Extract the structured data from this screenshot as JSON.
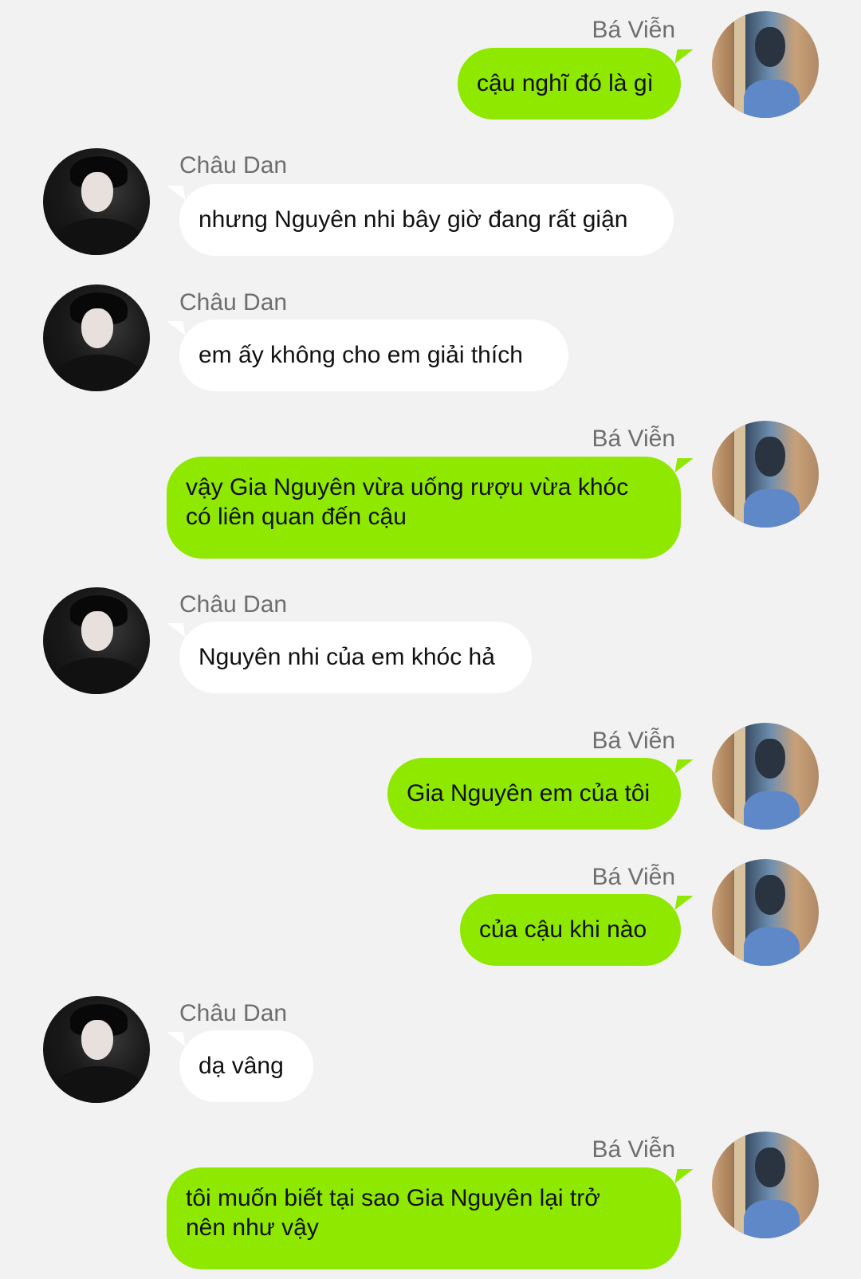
{
  "messages": [
    {
      "sender": "Bá Viễn",
      "text": "cậu nghĩ đó là gì"
    },
    {
      "sender": "Châu Dan",
      "text": "nhưng Nguyên nhi bây giờ đang rất giận"
    },
    {
      "sender": "Châu Dan",
      "text": "em ấy không cho em giải thích"
    },
    {
      "sender": "Bá Viễn",
      "text": "vậy Gia Nguyên vừa uống rượu vừa khóc\ncó liên quan đến cậu"
    },
    {
      "sender": "Châu Dan",
      "text": "Nguyên nhi của em khóc hả"
    },
    {
      "sender": "Bá Viễn",
      "text": "Gia Nguyên em của tôi"
    },
    {
      "sender": "Bá Viễn",
      "text": "của cậu khi nào"
    },
    {
      "sender": "Châu Dan",
      "text": "dạ vâng"
    },
    {
      "sender": "Bá Viễn",
      "text": "tôi muốn biết tại sao Gia Nguyên lại trở\nnên như vậy"
    }
  ],
  "colors": {
    "background": "#f2f2f2",
    "outgoing_bubble": "#8fe800",
    "incoming_bubble": "#ffffff",
    "sender_name": "#6e6e6e"
  },
  "icons": {
    "outgoing_avatar": "user-avatar-photo",
    "incoming_avatar": "user-avatar-photo"
  }
}
